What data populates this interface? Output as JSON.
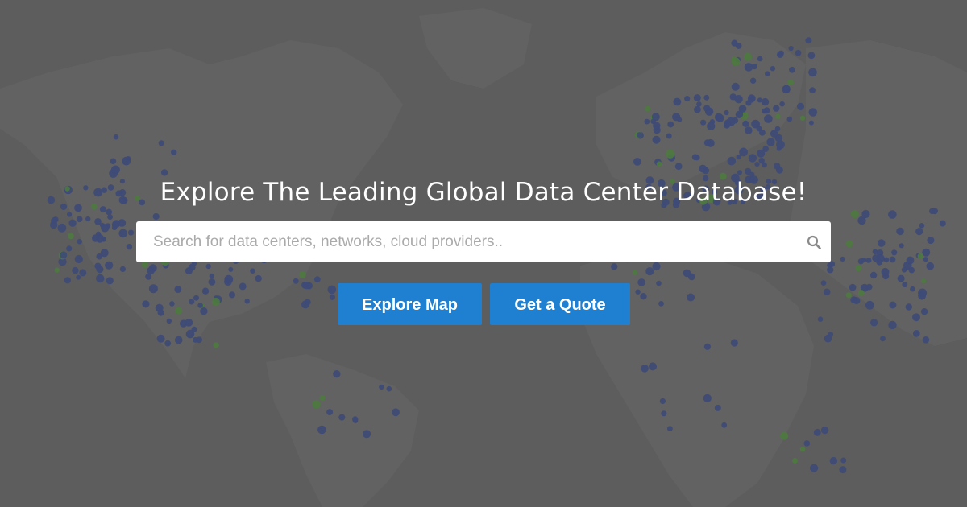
{
  "hero": {
    "title": "Explore The Leading Global Data Center Database!"
  },
  "search": {
    "placeholder": "Search for data centers, networks, cloud providers..",
    "value": "",
    "icon": "search-icon"
  },
  "actions": {
    "explore_map_label": "Explore Map",
    "quote_label": "Get a Quote"
  },
  "colors": {
    "background": "#5c5c5c",
    "button": "#1f7fd0",
    "marker_datacenter": "#3e4a78",
    "marker_other": "#4d7a3e"
  }
}
